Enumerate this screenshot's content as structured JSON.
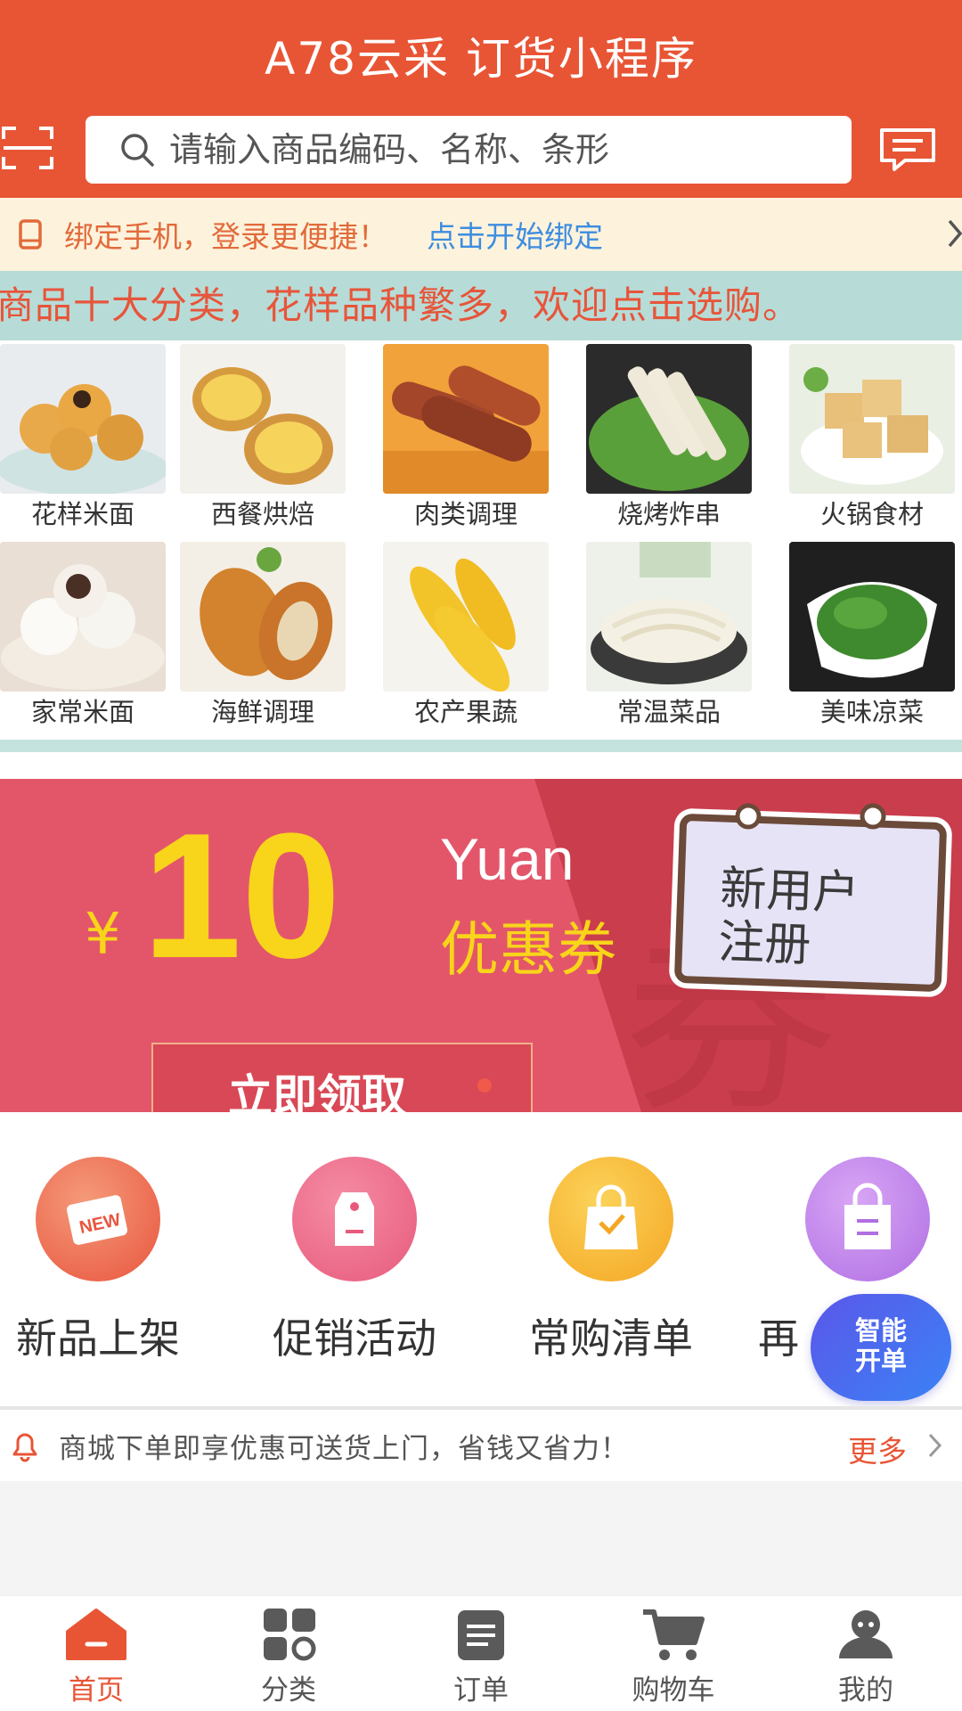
{
  "header": {
    "title": "A78云采 订货小程序",
    "search_placeholder": "请输入商品编码、名称、条形"
  },
  "bind_bar": {
    "text": "绑定手机，登录更便捷！",
    "link": "点击开始绑定"
  },
  "marquee": "商品十大分类，花样品种繁多，欢迎点击选购。",
  "categories": [
    {
      "label": "花样米面"
    },
    {
      "label": "西餐烘焙"
    },
    {
      "label": "肉类调理"
    },
    {
      "label": "烧烤炸串"
    },
    {
      "label": "火锅食材"
    },
    {
      "label": "家常米面"
    },
    {
      "label": "海鲜调理"
    },
    {
      "label": "农产果蔬"
    },
    {
      "label": "常温菜品"
    },
    {
      "label": "美味凉菜"
    }
  ],
  "banner": {
    "currency": "¥",
    "amount": "10",
    "unit_en": "Yuan",
    "coupon": "优惠券",
    "sign_line1": "新用户",
    "sign_line2": "注册",
    "claim_button": "立即领取"
  },
  "quick_links": [
    {
      "label": "新品上架",
      "icon": "new-tag-icon"
    },
    {
      "label": "促销活动",
      "icon": "price-tag-icon"
    },
    {
      "label": "常购清单",
      "icon": "shopping-bag-icon"
    },
    {
      "label": "再",
      "icon": "reorder-bag-icon"
    }
  ],
  "smart_order": {
    "line1": "智能",
    "line2": "开单"
  },
  "notice": {
    "text": "商城下单即享优惠可送货上门，省钱又省力！",
    "more": "更多"
  },
  "bottom_nav": [
    {
      "label": "首页",
      "icon": "home-icon",
      "active": true
    },
    {
      "label": "分类",
      "icon": "category-icon",
      "active": false
    },
    {
      "label": "订单",
      "icon": "order-icon",
      "active": false
    },
    {
      "label": "购物车",
      "icon": "cart-icon",
      "active": false
    },
    {
      "label": "我的",
      "icon": "profile-icon",
      "active": false
    }
  ],
  "colors": {
    "brand": "#e85535",
    "banner": "#e3566a",
    "coupon_yellow": "#f8d51a",
    "link_blue": "#3d8de0"
  }
}
